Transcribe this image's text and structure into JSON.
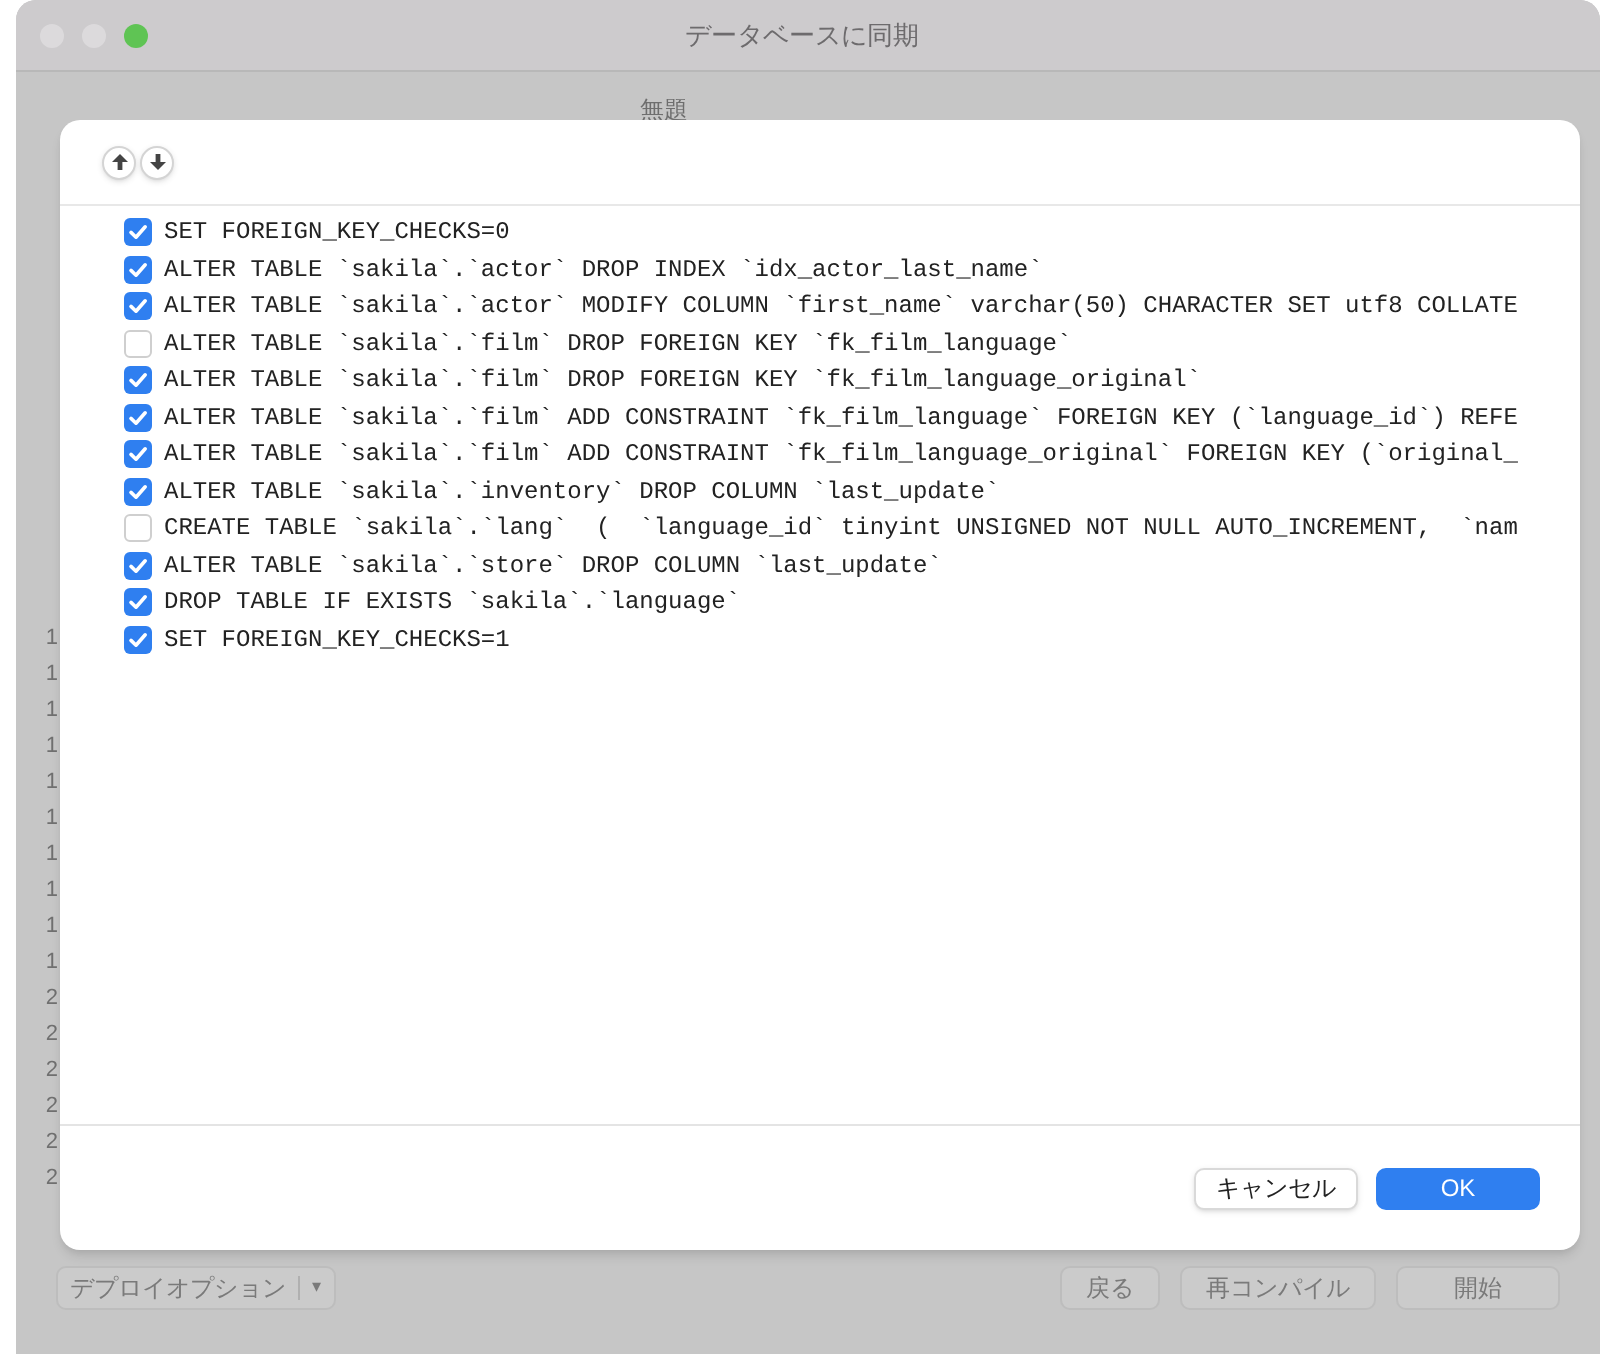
{
  "window": {
    "title": "データベースに同期"
  },
  "background": {
    "source_name": "無題",
    "line_numbers": [
      "1",
      "1",
      "1",
      "1",
      "1",
      "1",
      "1",
      "1",
      "1",
      "1",
      "2",
      "2",
      "2",
      "2",
      "2",
      "2"
    ],
    "deploy_options": {
      "label": "デプロイオプション",
      "arrow": "▾"
    },
    "buttons": [
      "戻る",
      "再コンパイル",
      "開始"
    ]
  },
  "dialog": {
    "statements": [
      {
        "text": "SET FOREIGN_KEY_CHECKS=0",
        "checked": true
      },
      {
        "text": "ALTER TABLE `sakila`.`actor` DROP INDEX `idx_actor_last_name`",
        "checked": true
      },
      {
        "text": "ALTER TABLE `sakila`.`actor` MODIFY COLUMN `first_name` varchar(50) CHARACTER SET utf8 COLLATE",
        "checked": true
      },
      {
        "text": "ALTER TABLE `sakila`.`film` DROP FOREIGN KEY `fk_film_language`",
        "checked": false
      },
      {
        "text": "ALTER TABLE `sakila`.`film` DROP FOREIGN KEY `fk_film_language_original`",
        "checked": true
      },
      {
        "text": "ALTER TABLE `sakila`.`film` ADD CONSTRAINT `fk_film_language` FOREIGN KEY (`language_id`) REFE",
        "checked": true
      },
      {
        "text": "ALTER TABLE `sakila`.`film` ADD CONSTRAINT `fk_film_language_original` FOREIGN KEY (`original_",
        "checked": true
      },
      {
        "text": "ALTER TABLE `sakila`.`inventory` DROP COLUMN `last_update`",
        "checked": true
      },
      {
        "text": "CREATE TABLE `sakila`.`lang`  (  `language_id` tinyint UNSIGNED NOT NULL AUTO_INCREMENT,  `nam",
        "checked": false
      },
      {
        "text": "ALTER TABLE `sakila`.`store` DROP COLUMN `last_update`",
        "checked": true
      },
      {
        "text": "DROP TABLE IF EXISTS `sakila`.`language`",
        "checked": true
      },
      {
        "text": "SET FOREIGN_KEY_CHECKS=1",
        "checked": true
      }
    ],
    "buttons": [
      {
        "label": "キャンセル",
        "kind": "secondary"
      },
      {
        "label": "OK",
        "kind": "primary"
      }
    ]
  }
}
